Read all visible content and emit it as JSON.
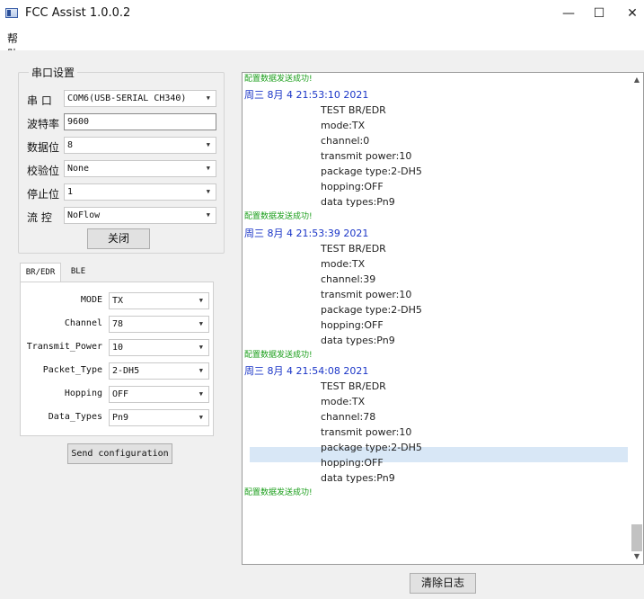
{
  "window": {
    "title": "FCC Assist 1.0.0.2",
    "minimize_glyph": "—",
    "maximize_glyph": "☐",
    "close_glyph": "✕"
  },
  "menu": {
    "help": "帮助(H)"
  },
  "serial": {
    "group_title": "串口设置",
    "port_label": "串  口",
    "port_value": "COM6(USB-SERIAL CH340)",
    "baud_label": "波特率",
    "baud_value": "9600",
    "data_bits_label": "数据位",
    "data_bits_value": "8",
    "parity_label": "校验位",
    "parity_value": "None",
    "stop_bits_label": "停止位",
    "stop_bits_value": "1",
    "flow_label": "流  控",
    "flow_value": "NoFlow",
    "close_button": "关闭"
  },
  "tabs": {
    "br_edr": "BR/EDR",
    "ble": "BLE"
  },
  "config": {
    "mode_label": "MODE",
    "mode_value": "TX",
    "channel_label": "Channel",
    "channel_value": "78",
    "power_label": "Transmit_Power",
    "power_value": "10",
    "packet_label": "Packet_Type",
    "packet_value": "2-DH5",
    "hopping_label": "Hopping",
    "hopping_value": "OFF",
    "data_label": "Data_Types",
    "data_value": "Pn9",
    "send_button": "Send configuration"
  },
  "log": {
    "lines": [
      {
        "type": "ok",
        "text": "配置数据发送成功!"
      },
      {
        "type": "date",
        "text": "周三 8月 4 21:53:10 2021"
      },
      {
        "type": "detail",
        "text": "TEST BR/EDR"
      },
      {
        "type": "detail",
        "text": "mode:TX"
      },
      {
        "type": "detail",
        "text": "channel:0"
      },
      {
        "type": "detail",
        "text": "transmit power:10"
      },
      {
        "type": "detail",
        "text": "package type:2-DH5"
      },
      {
        "type": "detail",
        "text": "hopping:OFF"
      },
      {
        "type": "detail",
        "text": "data types:Pn9"
      },
      {
        "type": "ok",
        "text": "配置数据发送成功!"
      },
      {
        "type": "date",
        "text": "周三 8月 4 21:53:39 2021"
      },
      {
        "type": "detail",
        "text": "TEST BR/EDR"
      },
      {
        "type": "detail",
        "text": "mode:TX"
      },
      {
        "type": "detail",
        "text": "channel:39"
      },
      {
        "type": "detail",
        "text": "transmit power:10"
      },
      {
        "type": "detail",
        "text": "package type:2-DH5"
      },
      {
        "type": "detail",
        "text": "hopping:OFF"
      },
      {
        "type": "detail",
        "text": "data types:Pn9"
      },
      {
        "type": "ok",
        "text": "配置数据发送成功!"
      },
      {
        "type": "date",
        "text": "周三 8月 4 21:54:08 2021"
      },
      {
        "type": "detail",
        "text": "TEST BR/EDR"
      },
      {
        "type": "detail",
        "text": "mode:TX"
      },
      {
        "type": "detail",
        "text": "channel:78"
      },
      {
        "type": "detail",
        "text": "transmit power:10"
      },
      {
        "type": "detail",
        "text": "package type:2-DH5"
      },
      {
        "type": "detail",
        "text": "hopping:OFF"
      },
      {
        "type": "detail",
        "text": "data types:Pn9"
      },
      {
        "type": "ok",
        "text": "配置数据发送成功!"
      }
    ],
    "clear_button": "清除日志"
  },
  "colors": {
    "ok": "#1a9e1a",
    "date": "#1a35c7",
    "selection": "#d8e7f6"
  },
  "icons": {
    "window_icon": "app-window-icon",
    "scroll_up": "chevron-up-icon",
    "scroll_down": "chevron-down-icon",
    "dropdown": "dropdown-arrow-icon"
  }
}
